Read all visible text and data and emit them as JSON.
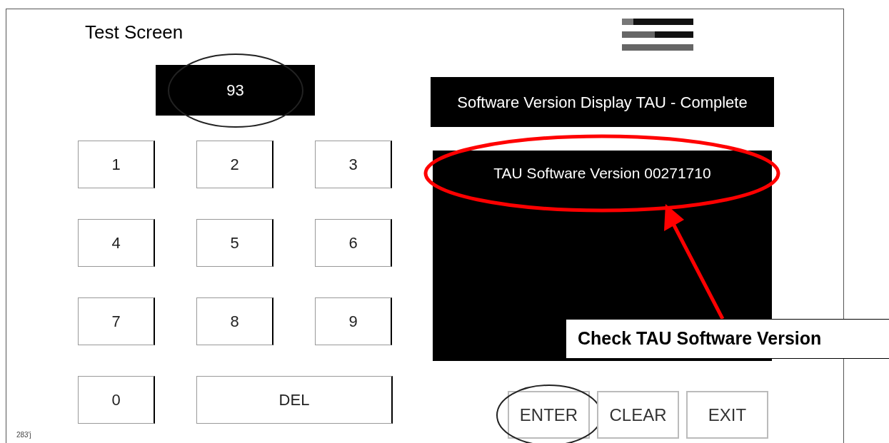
{
  "title": "Test Screen",
  "display": {
    "value": "93",
    "circled": true
  },
  "keypad": [
    {
      "label": "1",
      "wide": false
    },
    {
      "label": "2",
      "wide": false
    },
    {
      "label": "3",
      "wide": false
    },
    {
      "label": "4",
      "wide": false
    },
    {
      "label": "5",
      "wide": false
    },
    {
      "label": "6",
      "wide": false
    },
    {
      "label": "7",
      "wide": false
    },
    {
      "label": "8",
      "wide": false
    },
    {
      "label": "9",
      "wide": false
    },
    {
      "label": "0",
      "wide": false
    },
    {
      "label": "DEL",
      "wide": true
    }
  ],
  "status_banner": "Software Version Display TAU - Complete",
  "result_lines": [
    {
      "text": "TAU Software Version 00271710",
      "circled": true
    }
  ],
  "actions": [
    {
      "label": "ENTER",
      "circled": true
    },
    {
      "label": "CLEAR",
      "circled": false
    },
    {
      "label": "EXIT",
      "circled": false
    }
  ],
  "callout": {
    "text": "Check TAU Software Version"
  },
  "figure_id": "283'j"
}
